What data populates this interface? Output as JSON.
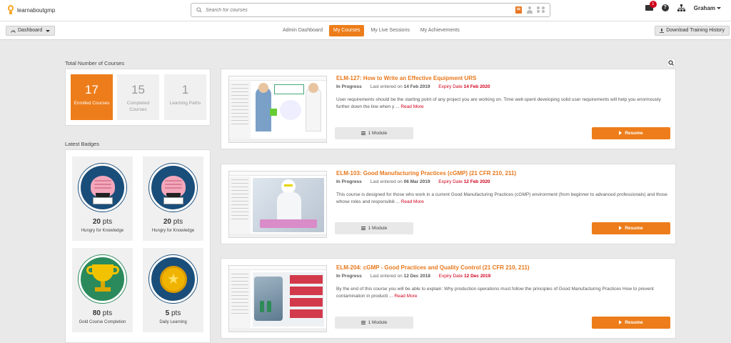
{
  "header": {
    "logo_text": "learnaboutgmp",
    "search_placeholder": "Search for courses",
    "notification_count": "1",
    "help_symbol": "?",
    "user_name": "Graham"
  },
  "subnav": {
    "dashboard_label": "Dashboard",
    "tabs": [
      {
        "label": "Admin Dashboard",
        "active": false
      },
      {
        "label": "My Courses",
        "active": true
      },
      {
        "label": "My Live Sessions",
        "active": false
      },
      {
        "label": "My Achievements",
        "active": false
      }
    ],
    "download_label": "Download Training History"
  },
  "stats": {
    "title": "Total Number of Courses",
    "items": [
      {
        "value": "17",
        "label": "Enrolled Courses"
      },
      {
        "value": "15",
        "label": "Completed Courses"
      },
      {
        "value": "1",
        "label": "Learning Paths"
      }
    ]
  },
  "badges": {
    "title": "Latest Badges",
    "pts_unit": "pts",
    "items": [
      {
        "points": "20",
        "name": "Hungry for Knowledge",
        "icon": "brain-book-icon"
      },
      {
        "points": "20",
        "name": "Hungry for Knowledge",
        "icon": "brain-book-icon"
      },
      {
        "points": "80",
        "name": "Gold Course Completion",
        "icon": "gold-trophy-icon"
      },
      {
        "points": "5",
        "name": "Daily Learning",
        "icon": "gold-star-coin-icon"
      }
    ]
  },
  "courses": [
    {
      "title": "ELM-127: How to Write an Effective Equipment URS",
      "status": "In Progress",
      "last_entered_label": "Last entered on",
      "last_entered": "14 Feb 2019",
      "expiry_label": "Expiry Date",
      "expiry": "14 Feb 2020",
      "description": "User requirements should be the starting point of any project you are working on. Time well-spent developing solid user requirements will help you enormously further down the line when y ...",
      "read_more": "Read More",
      "modules": "1 Module",
      "resume": "Resume"
    },
    {
      "title": "ELM-103: Good Manufacturing Practices (cGMP) (21 CFR 210, 211)",
      "status": "In Progress",
      "last_entered_label": "Last entered on",
      "last_entered": "06 Mar 2019",
      "expiry_label": "Expiry Date",
      "expiry": "12 Feb 2020",
      "description": "This course is designed for those who work in a current Good Manufacturing Practices (cGMP) environment (from beginner to advanced professionals) and those whose roles and responsibili ...",
      "read_more": "Read More",
      "modules": "1 Module",
      "resume": "Resume"
    },
    {
      "title": "ELM-204: cGMP - Good Practices and Quality Control (21 CFR 210, 211)",
      "status": "In Progress",
      "last_entered_label": "Last entered on",
      "last_entered": "12 Dec 2018",
      "expiry_label": "Expiry Date",
      "expiry": "12 Dec 2019",
      "description": "By the end of this course you will be able to explain: Why production operations must follow the principles of Good Manufacturing Practices How to prevent contamination in producti ...",
      "read_more": "Read More",
      "modules": "1 Module",
      "resume": "Resume"
    }
  ]
}
